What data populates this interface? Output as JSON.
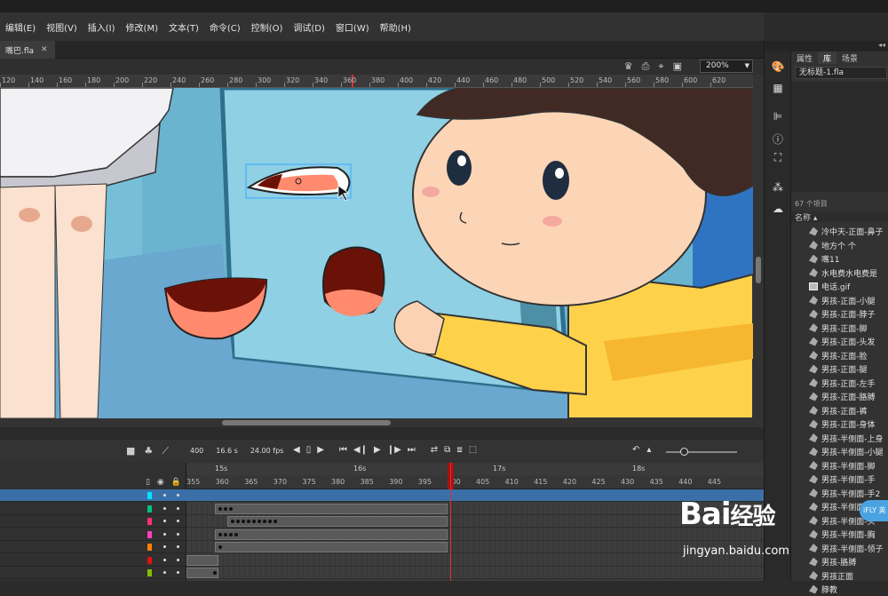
{
  "menu": [
    "编辑(E)",
    "视图(V)",
    "插入(I)",
    "修改(M)",
    "文本(T)",
    "命令(C)",
    "控制(O)",
    "调试(D)",
    "窗口(W)",
    "帮助(H)"
  ],
  "document_tab": {
    "name": "嘴巴.fla",
    "close": "✕"
  },
  "edit_bar": {
    "zoom": "200%"
  },
  "ruler_labels": [
    "120",
    "140",
    "160",
    "180",
    "200",
    "220",
    "240",
    "260",
    "280",
    "300",
    "320",
    "340",
    "360",
    "380",
    "400",
    "420",
    "440",
    "460",
    "480",
    "500",
    "520",
    "540",
    "560",
    "580",
    "600",
    "620"
  ],
  "timeline": {
    "frame_count": "400",
    "time": "16.6 s",
    "fps": "24.00 fps",
    "second_labels": [
      "15s",
      "16s",
      "17s",
      "18s"
    ],
    "frame_labels": [
      "355",
      "360",
      "365",
      "370",
      "375",
      "380",
      "385",
      "390",
      "395",
      "400",
      "405",
      "410",
      "415",
      "420",
      "425",
      "430",
      "435",
      "440",
      "445"
    ],
    "layer_colors": [
      "#00e5ff",
      "#00c080",
      "#ff3070",
      "#ff40c0",
      "#ff8000",
      "#e01010",
      "#80c000"
    ]
  },
  "panel": {
    "tabs": [
      "属性",
      "库",
      "场景"
    ],
    "active_tab": "库",
    "library_file": "无标题-1.fla",
    "item_count": "67 个项目",
    "column_header": "名称 ▴",
    "items": [
      {
        "name": "冷中天-正面-鼻子",
        "icon": "symbol"
      },
      {
        "name": "地方个 个",
        "icon": "symbol"
      },
      {
        "name": "嘴11",
        "icon": "symbol"
      },
      {
        "name": "水电费水电费是",
        "icon": "symbol"
      },
      {
        "name": "电话.gif",
        "icon": "bitmap"
      },
      {
        "name": "男孩-正面-小腿",
        "icon": "symbol"
      },
      {
        "name": "男孩-正面-脖子",
        "icon": "symbol"
      },
      {
        "name": "男孩-正面-脚",
        "icon": "symbol"
      },
      {
        "name": "男孩-正面-头发",
        "icon": "symbol"
      },
      {
        "name": "男孩-正面-脸",
        "icon": "symbol"
      },
      {
        "name": "男孩-正面-腿",
        "icon": "symbol"
      },
      {
        "name": "男孩-正面-左手",
        "icon": "symbol"
      },
      {
        "name": "男孩-正面-胳膊",
        "icon": "symbol"
      },
      {
        "name": "男孩-正面-裤",
        "icon": "symbol"
      },
      {
        "name": "男孩-正面-身体",
        "icon": "symbol"
      },
      {
        "name": "男孩-半侧面-上身",
        "icon": "symbol"
      },
      {
        "name": "男孩-半侧面-小腿",
        "icon": "symbol"
      },
      {
        "name": "男孩-半侧面-脚",
        "icon": "symbol"
      },
      {
        "name": "男孩-半侧面-手",
        "icon": "symbol"
      },
      {
        "name": "男孩-半侧面-手2",
        "icon": "symbol"
      },
      {
        "name": "男孩-半侧面-腿",
        "icon": "symbol"
      },
      {
        "name": "男孩-半侧面-头",
        "icon": "symbol"
      },
      {
        "name": "男孩-半侧面-胸",
        "icon": "symbol"
      },
      {
        "name": "男孩-半侧面-领子",
        "icon": "symbol"
      },
      {
        "name": "男孩-胳膊",
        "icon": "symbol"
      },
      {
        "name": "男孩正面",
        "icon": "symbol"
      },
      {
        "name": "脖教",
        "icon": "symbol"
      }
    ]
  },
  "watermark": {
    "main": "Bai",
    "cn": "经验",
    "url": "jingyan.baidu.com"
  },
  "ifly_badge": "iFLY 英"
}
